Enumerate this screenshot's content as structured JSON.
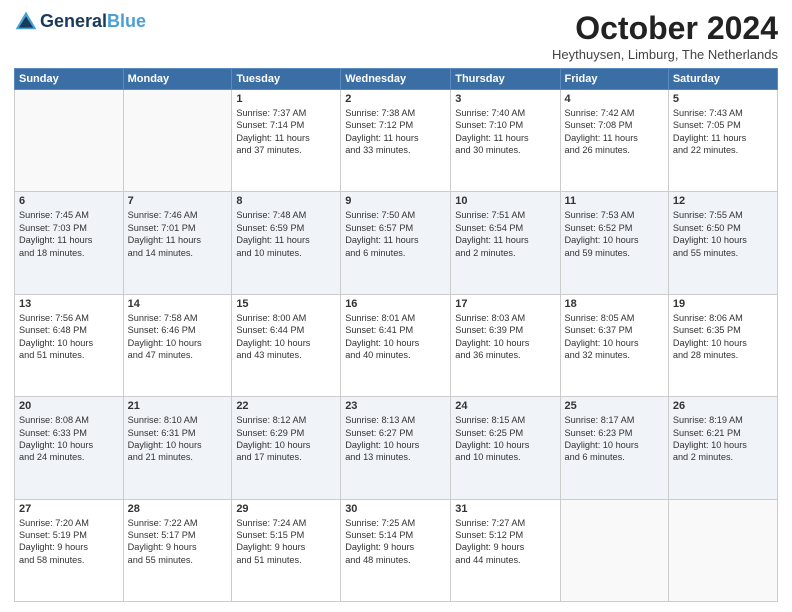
{
  "header": {
    "logo_line1": "General",
    "logo_line2": "Blue",
    "month_title": "October 2024",
    "location": "Heythuysen, Limburg, The Netherlands"
  },
  "weekdays": [
    "Sunday",
    "Monday",
    "Tuesday",
    "Wednesday",
    "Thursday",
    "Friday",
    "Saturday"
  ],
  "weeks": [
    [
      {
        "day": "",
        "info": ""
      },
      {
        "day": "",
        "info": ""
      },
      {
        "day": "1",
        "info": "Sunrise: 7:37 AM\nSunset: 7:14 PM\nDaylight: 11 hours\nand 37 minutes."
      },
      {
        "day": "2",
        "info": "Sunrise: 7:38 AM\nSunset: 7:12 PM\nDaylight: 11 hours\nand 33 minutes."
      },
      {
        "day": "3",
        "info": "Sunrise: 7:40 AM\nSunset: 7:10 PM\nDaylight: 11 hours\nand 30 minutes."
      },
      {
        "day": "4",
        "info": "Sunrise: 7:42 AM\nSunset: 7:08 PM\nDaylight: 11 hours\nand 26 minutes."
      },
      {
        "day": "5",
        "info": "Sunrise: 7:43 AM\nSunset: 7:05 PM\nDaylight: 11 hours\nand 22 minutes."
      }
    ],
    [
      {
        "day": "6",
        "info": "Sunrise: 7:45 AM\nSunset: 7:03 PM\nDaylight: 11 hours\nand 18 minutes."
      },
      {
        "day": "7",
        "info": "Sunrise: 7:46 AM\nSunset: 7:01 PM\nDaylight: 11 hours\nand 14 minutes."
      },
      {
        "day": "8",
        "info": "Sunrise: 7:48 AM\nSunset: 6:59 PM\nDaylight: 11 hours\nand 10 minutes."
      },
      {
        "day": "9",
        "info": "Sunrise: 7:50 AM\nSunset: 6:57 PM\nDaylight: 11 hours\nand 6 minutes."
      },
      {
        "day": "10",
        "info": "Sunrise: 7:51 AM\nSunset: 6:54 PM\nDaylight: 11 hours\nand 2 minutes."
      },
      {
        "day": "11",
        "info": "Sunrise: 7:53 AM\nSunset: 6:52 PM\nDaylight: 10 hours\nand 59 minutes."
      },
      {
        "day": "12",
        "info": "Sunrise: 7:55 AM\nSunset: 6:50 PM\nDaylight: 10 hours\nand 55 minutes."
      }
    ],
    [
      {
        "day": "13",
        "info": "Sunrise: 7:56 AM\nSunset: 6:48 PM\nDaylight: 10 hours\nand 51 minutes."
      },
      {
        "day": "14",
        "info": "Sunrise: 7:58 AM\nSunset: 6:46 PM\nDaylight: 10 hours\nand 47 minutes."
      },
      {
        "day": "15",
        "info": "Sunrise: 8:00 AM\nSunset: 6:44 PM\nDaylight: 10 hours\nand 43 minutes."
      },
      {
        "day": "16",
        "info": "Sunrise: 8:01 AM\nSunset: 6:41 PM\nDaylight: 10 hours\nand 40 minutes."
      },
      {
        "day": "17",
        "info": "Sunrise: 8:03 AM\nSunset: 6:39 PM\nDaylight: 10 hours\nand 36 minutes."
      },
      {
        "day": "18",
        "info": "Sunrise: 8:05 AM\nSunset: 6:37 PM\nDaylight: 10 hours\nand 32 minutes."
      },
      {
        "day": "19",
        "info": "Sunrise: 8:06 AM\nSunset: 6:35 PM\nDaylight: 10 hours\nand 28 minutes."
      }
    ],
    [
      {
        "day": "20",
        "info": "Sunrise: 8:08 AM\nSunset: 6:33 PM\nDaylight: 10 hours\nand 24 minutes."
      },
      {
        "day": "21",
        "info": "Sunrise: 8:10 AM\nSunset: 6:31 PM\nDaylight: 10 hours\nand 21 minutes."
      },
      {
        "day": "22",
        "info": "Sunrise: 8:12 AM\nSunset: 6:29 PM\nDaylight: 10 hours\nand 17 minutes."
      },
      {
        "day": "23",
        "info": "Sunrise: 8:13 AM\nSunset: 6:27 PM\nDaylight: 10 hours\nand 13 minutes."
      },
      {
        "day": "24",
        "info": "Sunrise: 8:15 AM\nSunset: 6:25 PM\nDaylight: 10 hours\nand 10 minutes."
      },
      {
        "day": "25",
        "info": "Sunrise: 8:17 AM\nSunset: 6:23 PM\nDaylight: 10 hours\nand 6 minutes."
      },
      {
        "day": "26",
        "info": "Sunrise: 8:19 AM\nSunset: 6:21 PM\nDaylight: 10 hours\nand 2 minutes."
      }
    ],
    [
      {
        "day": "27",
        "info": "Sunrise: 7:20 AM\nSunset: 5:19 PM\nDaylight: 9 hours\nand 58 minutes."
      },
      {
        "day": "28",
        "info": "Sunrise: 7:22 AM\nSunset: 5:17 PM\nDaylight: 9 hours\nand 55 minutes."
      },
      {
        "day": "29",
        "info": "Sunrise: 7:24 AM\nSunset: 5:15 PM\nDaylight: 9 hours\nand 51 minutes."
      },
      {
        "day": "30",
        "info": "Sunrise: 7:25 AM\nSunset: 5:14 PM\nDaylight: 9 hours\nand 48 minutes."
      },
      {
        "day": "31",
        "info": "Sunrise: 7:27 AM\nSunset: 5:12 PM\nDaylight: 9 hours\nand 44 minutes."
      },
      {
        "day": "",
        "info": ""
      },
      {
        "day": "",
        "info": ""
      }
    ]
  ]
}
